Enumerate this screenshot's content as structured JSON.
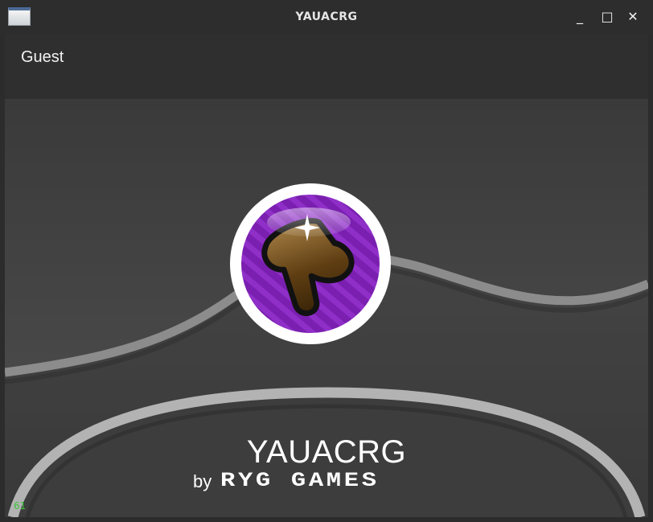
{
  "window": {
    "title": "YAUACRG",
    "minimize_glyph": "_",
    "maximize_glyph": "□",
    "close_glyph": "✕"
  },
  "topbar": {
    "username": "Guest"
  },
  "splash": {
    "logo_icon": "pointer-hand-badge-icon",
    "title": "YAUACRG",
    "by": "by",
    "studio": "RYG GAMES"
  },
  "overlay": {
    "fps": "61"
  },
  "colors": {
    "logo_purple": "#7a1fb0",
    "logo_ring": "#ffffff",
    "wave": "#8f8f8f",
    "fps_green": "#3cc43c"
  }
}
